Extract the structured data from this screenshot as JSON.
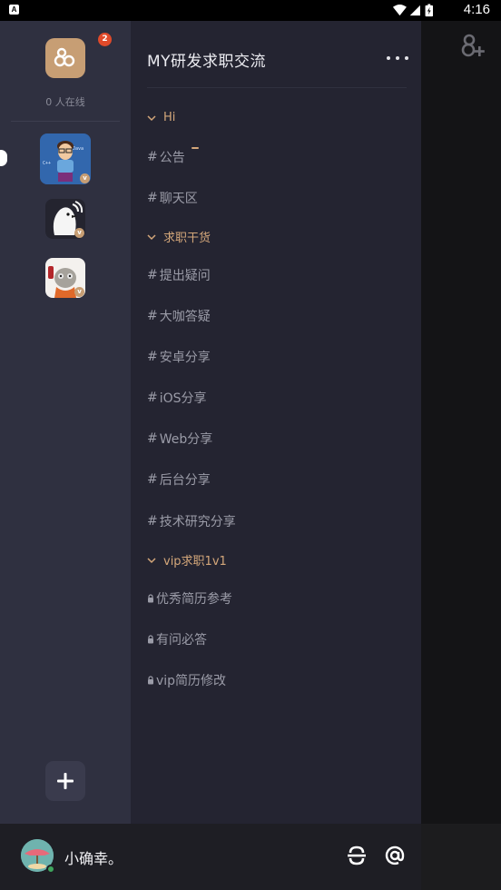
{
  "status_bar": {
    "notification_icon": "A",
    "time": "4:16",
    "icons": [
      "wifi-icon",
      "signal-icon",
      "battery-icon"
    ]
  },
  "servers": {
    "home_icon": "group-logo-icon",
    "badge_count": "2",
    "online_text": "0 人在线",
    "items": [
      {
        "name": "server-avatar-cartoon-boy",
        "badge": "v"
      },
      {
        "name": "server-avatar-penguin",
        "badge": "v"
      },
      {
        "name": "server-avatar-meme",
        "badge": "v"
      }
    ],
    "add_icon": "plus-icon"
  },
  "channel_panel": {
    "title": "MY研发求职交流",
    "more_icon": "more-horizontal-icon",
    "categories": [
      {
        "label": "Hi",
        "channels": [
          {
            "prefix": "#",
            "label": "公告",
            "unread": true
          },
          {
            "prefix": "#",
            "label": "聊天区"
          }
        ]
      },
      {
        "label": "求职干货",
        "channels": [
          {
            "prefix": "#",
            "label": "提出疑问⁣"
          },
          {
            "prefix": "#",
            "label": "大咖答疑"
          },
          {
            "prefix": "#",
            "label": "安卓分享"
          },
          {
            "prefix": "#",
            "label": "iOS分享"
          },
          {
            "prefix": "#",
            "label": "Web分享"
          },
          {
            "prefix": "#",
            "label": "后台分享"
          },
          {
            "prefix": "#",
            "label": "技术研究分享"
          }
        ]
      },
      {
        "label": "vip求职1v1",
        "channels": [
          {
            "prefix": "lock",
            "label": "优秀简历参考"
          },
          {
            "prefix": "lock",
            "label": "有问必答"
          },
          {
            "prefix": "lock",
            "label": "vip简历修改"
          }
        ]
      }
    ]
  },
  "right_panel": {
    "add_member_icon": "add-member-icon"
  },
  "user_bar": {
    "username": "小确幸。",
    "status": "online",
    "icons": [
      "voice-channel-icon",
      "mention-icon"
    ]
  },
  "colors": {
    "accent": "#d4a77a",
    "server_bg": "#2f3040",
    "channel_bg": "#242431",
    "badge": "#e04a2a",
    "online": "#3fa55d"
  }
}
